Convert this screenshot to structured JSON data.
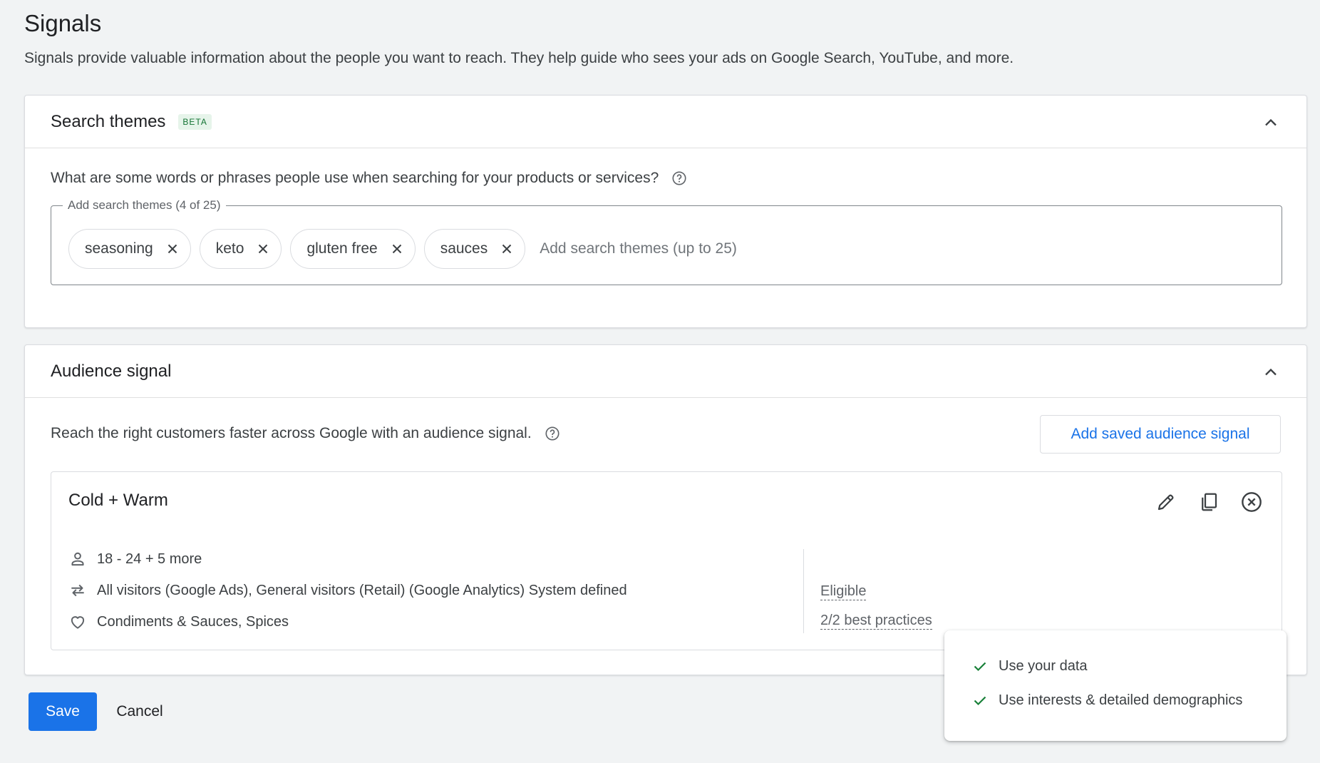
{
  "page": {
    "title": "Signals",
    "description": "Signals provide valuable information about the people you want to reach. They help guide who sees your ads on Google Search, YouTube, and more."
  },
  "search_themes": {
    "title": "Search themes",
    "badge": "BETA",
    "question": "What are some words or phrases people use when searching for your products or services?",
    "field_label": "Add search themes (4 of 25)",
    "input_placeholder": "Add search themes (up to 25)",
    "chips": [
      "seasoning",
      "keto",
      "gluten free",
      "sauces"
    ]
  },
  "audience_signal": {
    "title": "Audience signal",
    "description": "Reach the right customers faster across Google with an audience signal.",
    "add_saved_label": "Add saved audience signal",
    "signal": {
      "name": "Cold + Warm",
      "demographics": "18 - 24 + 5 more",
      "your_data": "All visitors (Google Ads), General visitors (Retail) (Google Analytics) System defined",
      "interests": "Condiments & Sauces, Spices",
      "status": "Eligible",
      "best_practices": "2/2 best practices"
    }
  },
  "tooltip": {
    "items": [
      "Use your data",
      "Use interests & detailed demographics"
    ]
  },
  "actions": {
    "save_label": "Save",
    "cancel_label": "Cancel"
  },
  "colors": {
    "primary": "#1a73e8",
    "beta_bg": "#e6f4ea",
    "beta_text": "#137333",
    "check": "#188038"
  }
}
